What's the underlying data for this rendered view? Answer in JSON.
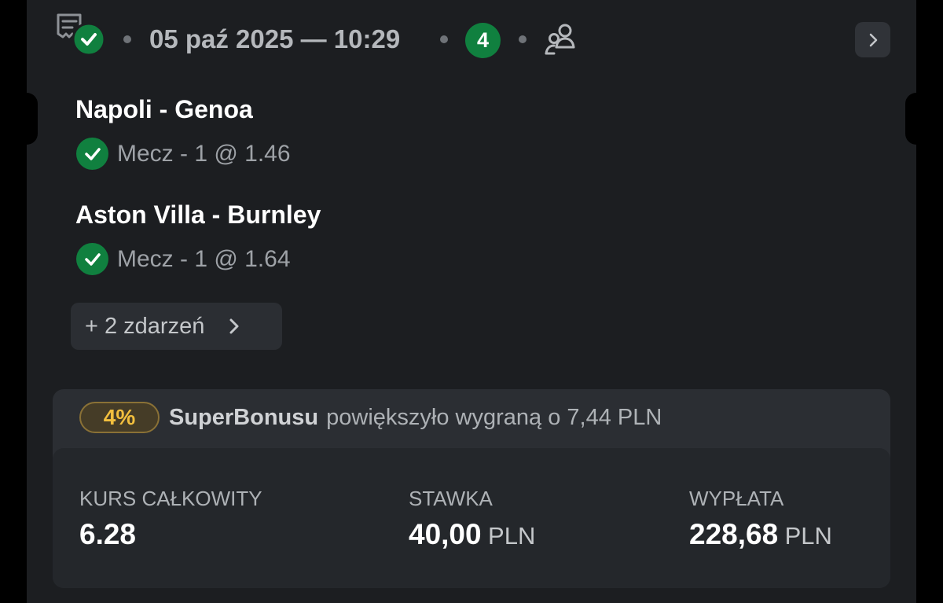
{
  "header": {
    "ticket_icon": "receipt-check-icon",
    "datetime": "05 paź 2025 — 10:29",
    "event_count": "4",
    "people_icon": "users-icon",
    "details_icon": "chevron-right-icon"
  },
  "events": [
    {
      "title": "Napoli - Genoa",
      "status_icon": "check-icon",
      "selection": "Mecz - 1 @ 1.46"
    },
    {
      "title": "Aston Villa - Burnley",
      "status_icon": "check-icon",
      "selection": "Mecz - 1 @ 1.64"
    }
  ],
  "more_events": {
    "label": "+ 2 zdarzeń",
    "icon": "chevron-right-icon"
  },
  "bonus": {
    "percent": "4%",
    "name": "SuperBonusu",
    "description": "powiększyło wygraną o 7,44 PLN"
  },
  "summary": {
    "total_odds": {
      "label": "KURS CAŁKOWITY",
      "value": "6.28"
    },
    "stake": {
      "label": "STAWKA",
      "value": "40,00",
      "currency": "PLN"
    },
    "payout": {
      "label": "WYPŁATA",
      "value": "228,68",
      "currency": "PLN"
    }
  },
  "colors": {
    "background": "#1c1e21",
    "success_green": "#10803f",
    "bonus_gold": "#f2bf3e",
    "panel": "#24272b"
  }
}
